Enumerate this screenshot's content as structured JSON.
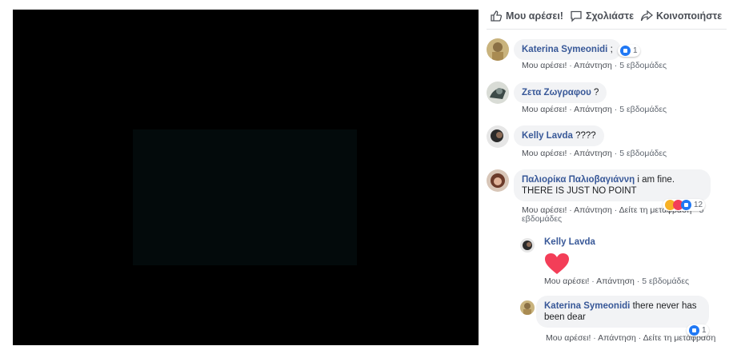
{
  "actions": {
    "like": "Μου αρέσει!",
    "comment": "Σχολιάστε",
    "share": "Κοινοποιήστε"
  },
  "comments": [
    {
      "author": "Katerina Symeonidi",
      "text": ";",
      "reaction_count": "1",
      "like": "Μου αρέσει!",
      "reply": "Απάντηση",
      "time": "5 εβδομάδες"
    },
    {
      "author": "Ζετα Ζωγραφου",
      "text": "?",
      "like": "Μου αρέσει!",
      "reply": "Απάντηση",
      "time": "5 εβδομάδες"
    },
    {
      "author": "Kelly Lavda",
      "text": "????",
      "like": "Μου αρέσει!",
      "reply": "Απάντηση",
      "time": "5 εβδομάδες"
    },
    {
      "author": "Παλιορίκα Παλιοβαγιάννη",
      "text_line1": "i am fine.",
      "text_line2": "THERE IS JUST NO POINT",
      "reaction_count": "12",
      "like": "Μου αρέσει!",
      "reply": "Απάντηση",
      "translate": "Δείτε τη μετάφραση",
      "time_part1": "5",
      "time_part2": "εβδομάδες"
    }
  ],
  "replies": [
    {
      "author": "Kelly Lavda",
      "sticker": "heart-icon",
      "like": "Μου αρέσει!",
      "reply": "Απάντηση",
      "time": "5 εβδομάδες"
    },
    {
      "author": "Katerina Symeonidi",
      "text_line1": "there never has",
      "text_line2": "been dear",
      "reaction_count": "1",
      "like": "Μου αρέσει!",
      "reply": "Απάντηση",
      "translate": "Δείτε τη μετάφραση"
    }
  ],
  "colors": {
    "link_blue": "#385898",
    "like_blue": "#2078f4",
    "heart_red": "#f33e58"
  }
}
